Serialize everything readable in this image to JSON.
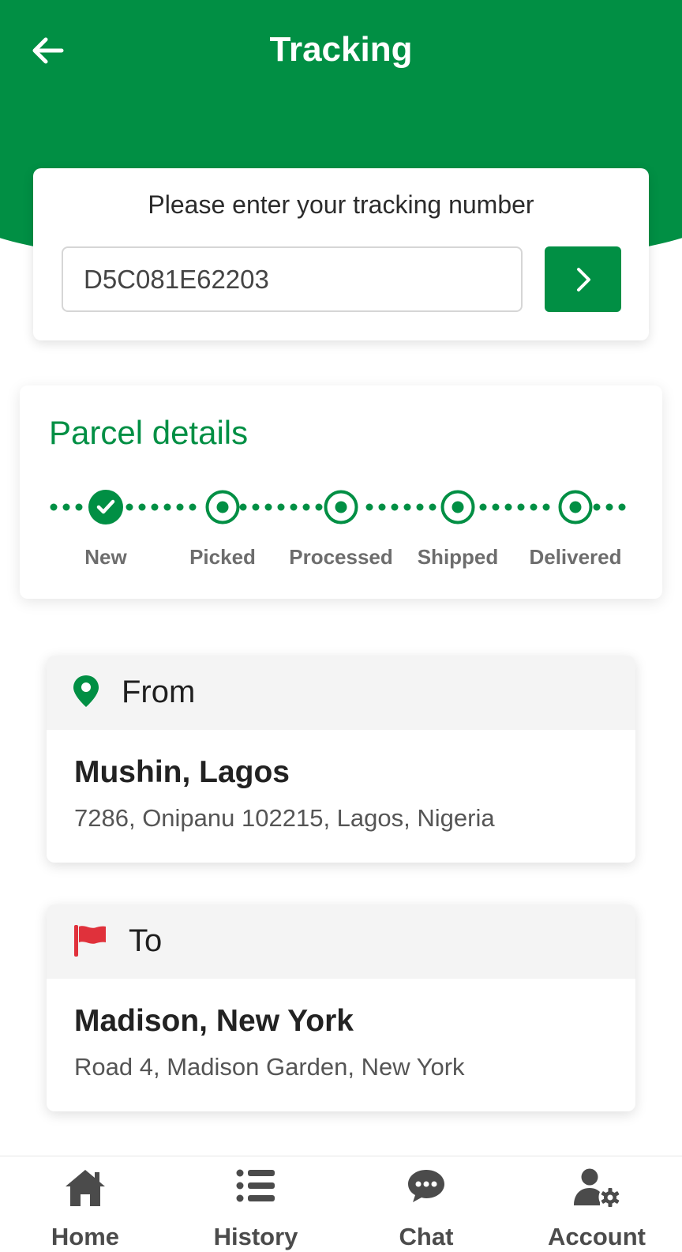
{
  "header": {
    "title": "Tracking",
    "back_icon": "arrow-left-icon"
  },
  "tracking": {
    "prompt": "Please enter your tracking number",
    "number": "D5C081E62203",
    "submit_icon": "chevron-right-icon"
  },
  "parcel": {
    "title": "Parcel details",
    "steps": [
      {
        "label": "New",
        "status": "done"
      },
      {
        "label": "Picked",
        "status": "pending"
      },
      {
        "label": "Processed",
        "status": "pending"
      },
      {
        "label": "Shipped",
        "status": "pending"
      },
      {
        "label": "Delivered",
        "status": "pending"
      }
    ]
  },
  "from": {
    "label": "From",
    "icon": "map-pin-icon",
    "city": "Mushin, Lagos",
    "street": "7286, Onipanu 102215, Lagos, Nigeria"
  },
  "to": {
    "label": "To",
    "icon": "flag-icon",
    "city": "Madison, New York",
    "street": "Road 4, Madison Garden, New York"
  },
  "nav": {
    "items": [
      {
        "label": "Home",
        "icon": "home-icon"
      },
      {
        "label": "History",
        "icon": "list-icon"
      },
      {
        "label": "Chat",
        "icon": "chat-icon"
      },
      {
        "label": "Account",
        "icon": "user-settings-icon"
      }
    ]
  },
  "colors": {
    "brand": "#018f44",
    "flag": "#e0313b",
    "nav_icon": "#4b4b4b",
    "step_label": "#6d6d6d"
  }
}
